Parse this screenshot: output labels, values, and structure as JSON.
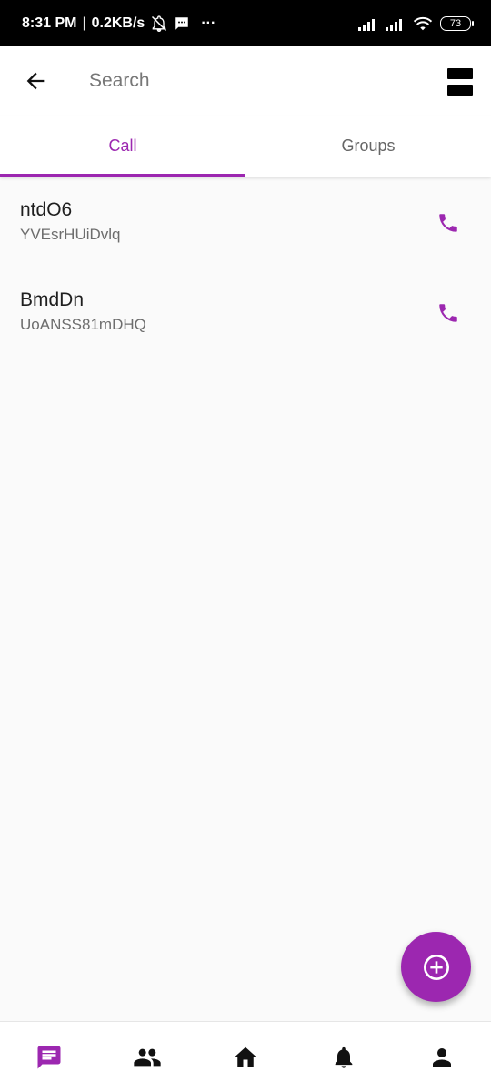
{
  "status_bar": {
    "time": "8:31 PM",
    "separator": "|",
    "speed": "0.2KB/s",
    "more": "···",
    "battery": "73"
  },
  "app_bar": {
    "search_placeholder": "Search",
    "back_icon": "arrow-back-icon",
    "view_icon": "view-agenda-icon"
  },
  "tabs": [
    {
      "label": "Call",
      "active": true
    },
    {
      "label": "Groups",
      "active": false
    }
  ],
  "contacts": [
    {
      "name": "ntdO6",
      "detail": "YVEsrHUiDvlq"
    },
    {
      "name": "BmdDn",
      "detail": "UoANSS81mDHQ"
    }
  ],
  "bottom_nav": [
    {
      "icon": "chat-icon",
      "active": true
    },
    {
      "icon": "people-icon",
      "active": false
    },
    {
      "icon": "home-icon",
      "active": false
    },
    {
      "icon": "bell-icon",
      "active": false
    },
    {
      "icon": "person-icon",
      "active": false
    }
  ],
  "colors": {
    "accent": "#9c27b0",
    "background": "#fafafa",
    "status_bar": "#000000"
  }
}
